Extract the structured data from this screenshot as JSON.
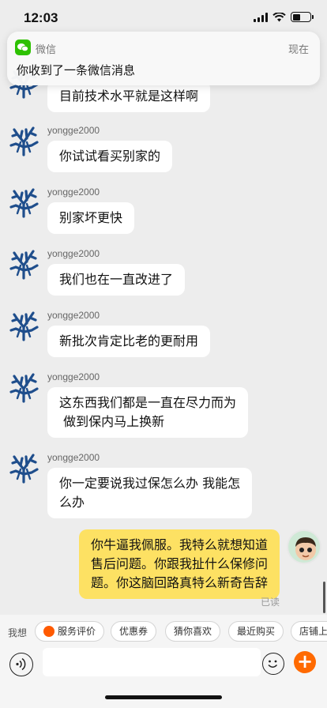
{
  "status_bar": {
    "time": "12:03"
  },
  "notification": {
    "app": "微信",
    "time": "现在",
    "text": "你收到了一条微信消息"
  },
  "messages": [
    {
      "sender": "",
      "text": "目前技术水平就是这样啊"
    },
    {
      "sender": "yongge2000",
      "text": "你试试看买别家的"
    },
    {
      "sender": "yongge2000",
      "text": "别家坏更快"
    },
    {
      "sender": "yongge2000",
      "text": "我们也在一直改进了"
    },
    {
      "sender": "yongge2000",
      "text": "新批次肯定比老的更耐用"
    },
    {
      "sender": "yongge2000",
      "text_line1": "这东西我们都是一直在尽力而为",
      "text_line2": " 做到保内马上换新"
    },
    {
      "sender": "yongge2000",
      "text_line1": "你一定要说我过保怎么办 我能怎",
      "text_line2": "么办"
    }
  ],
  "own_message": {
    "line1": "你牛逼我佩服。我特么就想知道",
    "line2": "售后问题。你跟我扯什么保修问",
    "line3": "题。你这脑回路真特么新奇告辞",
    "status": "已读"
  },
  "quick_bar": {
    "label": "我想",
    "chips": [
      "服务评价",
      "优惠券",
      "猜你喜欢",
      "最近购买",
      "店铺上"
    ]
  },
  "input": {
    "value": "",
    "placeholder": ""
  },
  "colors": {
    "accent": "#ff6a00",
    "own_bubble": "#fde163",
    "wechat_green": "#2dc100",
    "avatar_blue": "#1f4e8c"
  }
}
